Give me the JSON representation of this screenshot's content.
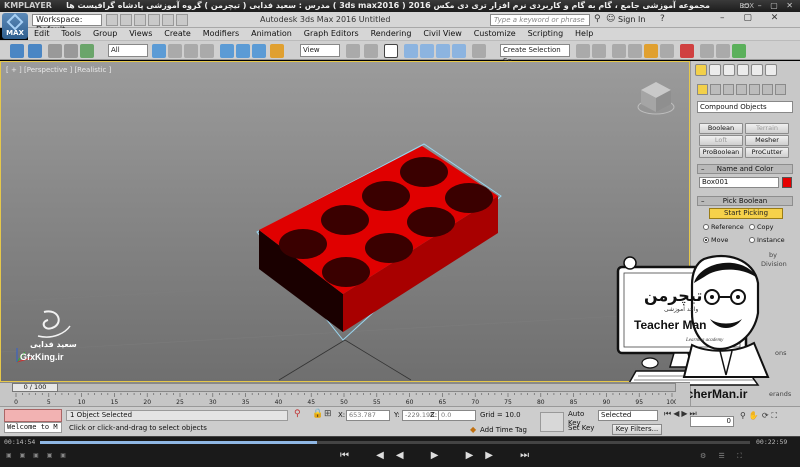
{
  "player": {
    "brand": "KMPLAYER",
    "caption": "مجموعه آموزشی جامع ، گام به گام و کاربردی نرم افزار تری دی مکس 3ds max2016 )  2016 )  مدرس : سعید فدایی ( تیچرمن ) گروه آموزشی پادشاه گرافیست ها",
    "box_label": "BOX",
    "window_controls": "▭ – ▢ ✕",
    "time_elapsed": "00:14:54",
    "time_total": "00:22:59",
    "progress_fraction": 0.39,
    "controls": "⏮ ◀◀ ▶ ▶▶ ⏭",
    "left_icons": "▣ ▣ ▣ ▣ ▣",
    "right_icons": "⚙ ☰ ⛶"
  },
  "app": {
    "logo_text": "MAX",
    "workspace": "Workspace: Default",
    "title": "Autodesk 3ds Max 2016    Untitled",
    "search_placeholder": "Type a keyword or phrase",
    "sign_in": "Sign In",
    "window_controls": "– ▢ ✕"
  },
  "menu": [
    "Edit",
    "Tools",
    "Group",
    "Views",
    "Create",
    "Modifiers",
    "Animation",
    "Graph Editors",
    "Rendering",
    "Civil View",
    "Customize",
    "Scripting",
    "Help"
  ],
  "toolbar": {
    "filter": "All",
    "ref_coord": "View",
    "named_sel": "Create Selection Se"
  },
  "viewport": {
    "label": "[ + ] [Perspective ] [Realistic ]",
    "object_color": "#e00000"
  },
  "command_panel": {
    "category": "Compound Objects",
    "buttons": [
      {
        "label": "Boolean",
        "enabled": true
      },
      {
        "label": "Terrain",
        "enabled": false
      },
      {
        "label": "Loft",
        "enabled": false
      },
      {
        "label": "Mesher",
        "enabled": true
      },
      {
        "label": "ProBoolean",
        "enabled": true
      },
      {
        "label": "ProCutter",
        "enabled": true
      }
    ],
    "name_color_title": "Name and Color",
    "object_name": "Box001",
    "object_swatch": "#e50000",
    "pick_title": "Pick Boolean",
    "start_picking": "Start Picking",
    "radio_reference": "Reference",
    "radio_copy": "Copy",
    "radio_move": "Move",
    "radio_instance": "Instance",
    "partial_by": "by",
    "partial_division": "Division",
    "partial_ons": "ons",
    "partial_erands": "erands"
  },
  "watermark": {
    "name": "سعید فدایی",
    "site": "GfxKing.ir"
  },
  "teacherman": {
    "logo_fa": "تیچرمن",
    "sub_fa": "واحد آموزشی",
    "logo_en": "Teacher Man",
    "tag": "Learning academy",
    "url": "www.TeacherMan.ir"
  },
  "timeslider": {
    "thumb": "0 / 100",
    "ticks": [
      "0",
      "5",
      "10",
      "15",
      "20",
      "25",
      "30",
      "35",
      "40",
      "45",
      "50",
      "55",
      "60",
      "65",
      "70",
      "75",
      "80",
      "85",
      "90",
      "95",
      "100"
    ]
  },
  "status": {
    "maxscript": "Welcome to M",
    "selection": "1 Object Selected",
    "prompt": "Click or click-and-drag to select objects",
    "x_label": "X:",
    "x": "653.787",
    "y_label": "Y:",
    "y": "-229.198",
    "z_label": "Z:",
    "z": "0.0",
    "grid": "Grid = 10.0",
    "add_time_tag": "Add Time Tag",
    "auto_key": "Auto Key",
    "set_key": "Set Key",
    "selected_dd": "Selected",
    "key_filters": "Key Filters...",
    "frame": "0"
  }
}
